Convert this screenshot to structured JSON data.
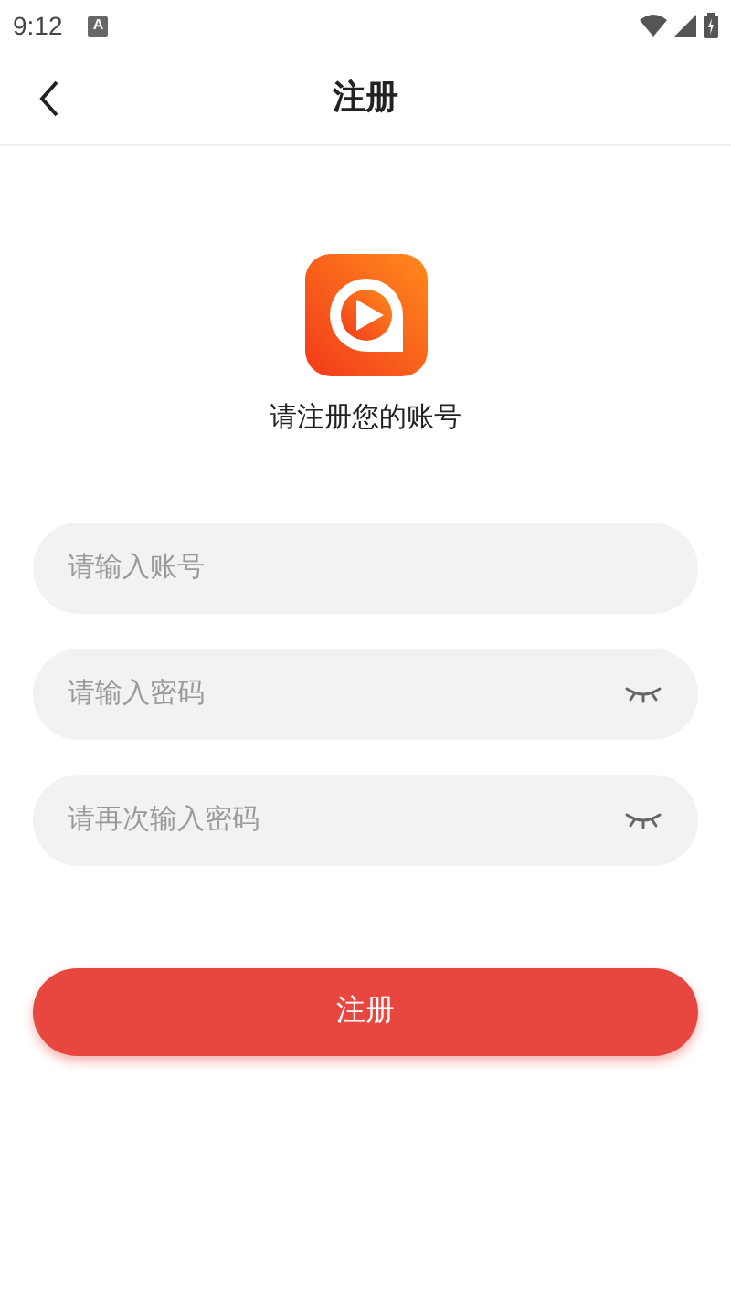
{
  "status_bar": {
    "time": "9:12",
    "notification": "A"
  },
  "header": {
    "title": "注册"
  },
  "logo": {
    "caption": "请注册您的账号"
  },
  "fields": [
    {
      "kind": "text",
      "placeholder": "请输入账号"
    },
    {
      "kind": "password",
      "placeholder": "请输入密码",
      "revealed": false
    },
    {
      "kind": "password",
      "placeholder": "请再次输入密码",
      "revealed": false
    }
  ],
  "submit_button": "注册"
}
